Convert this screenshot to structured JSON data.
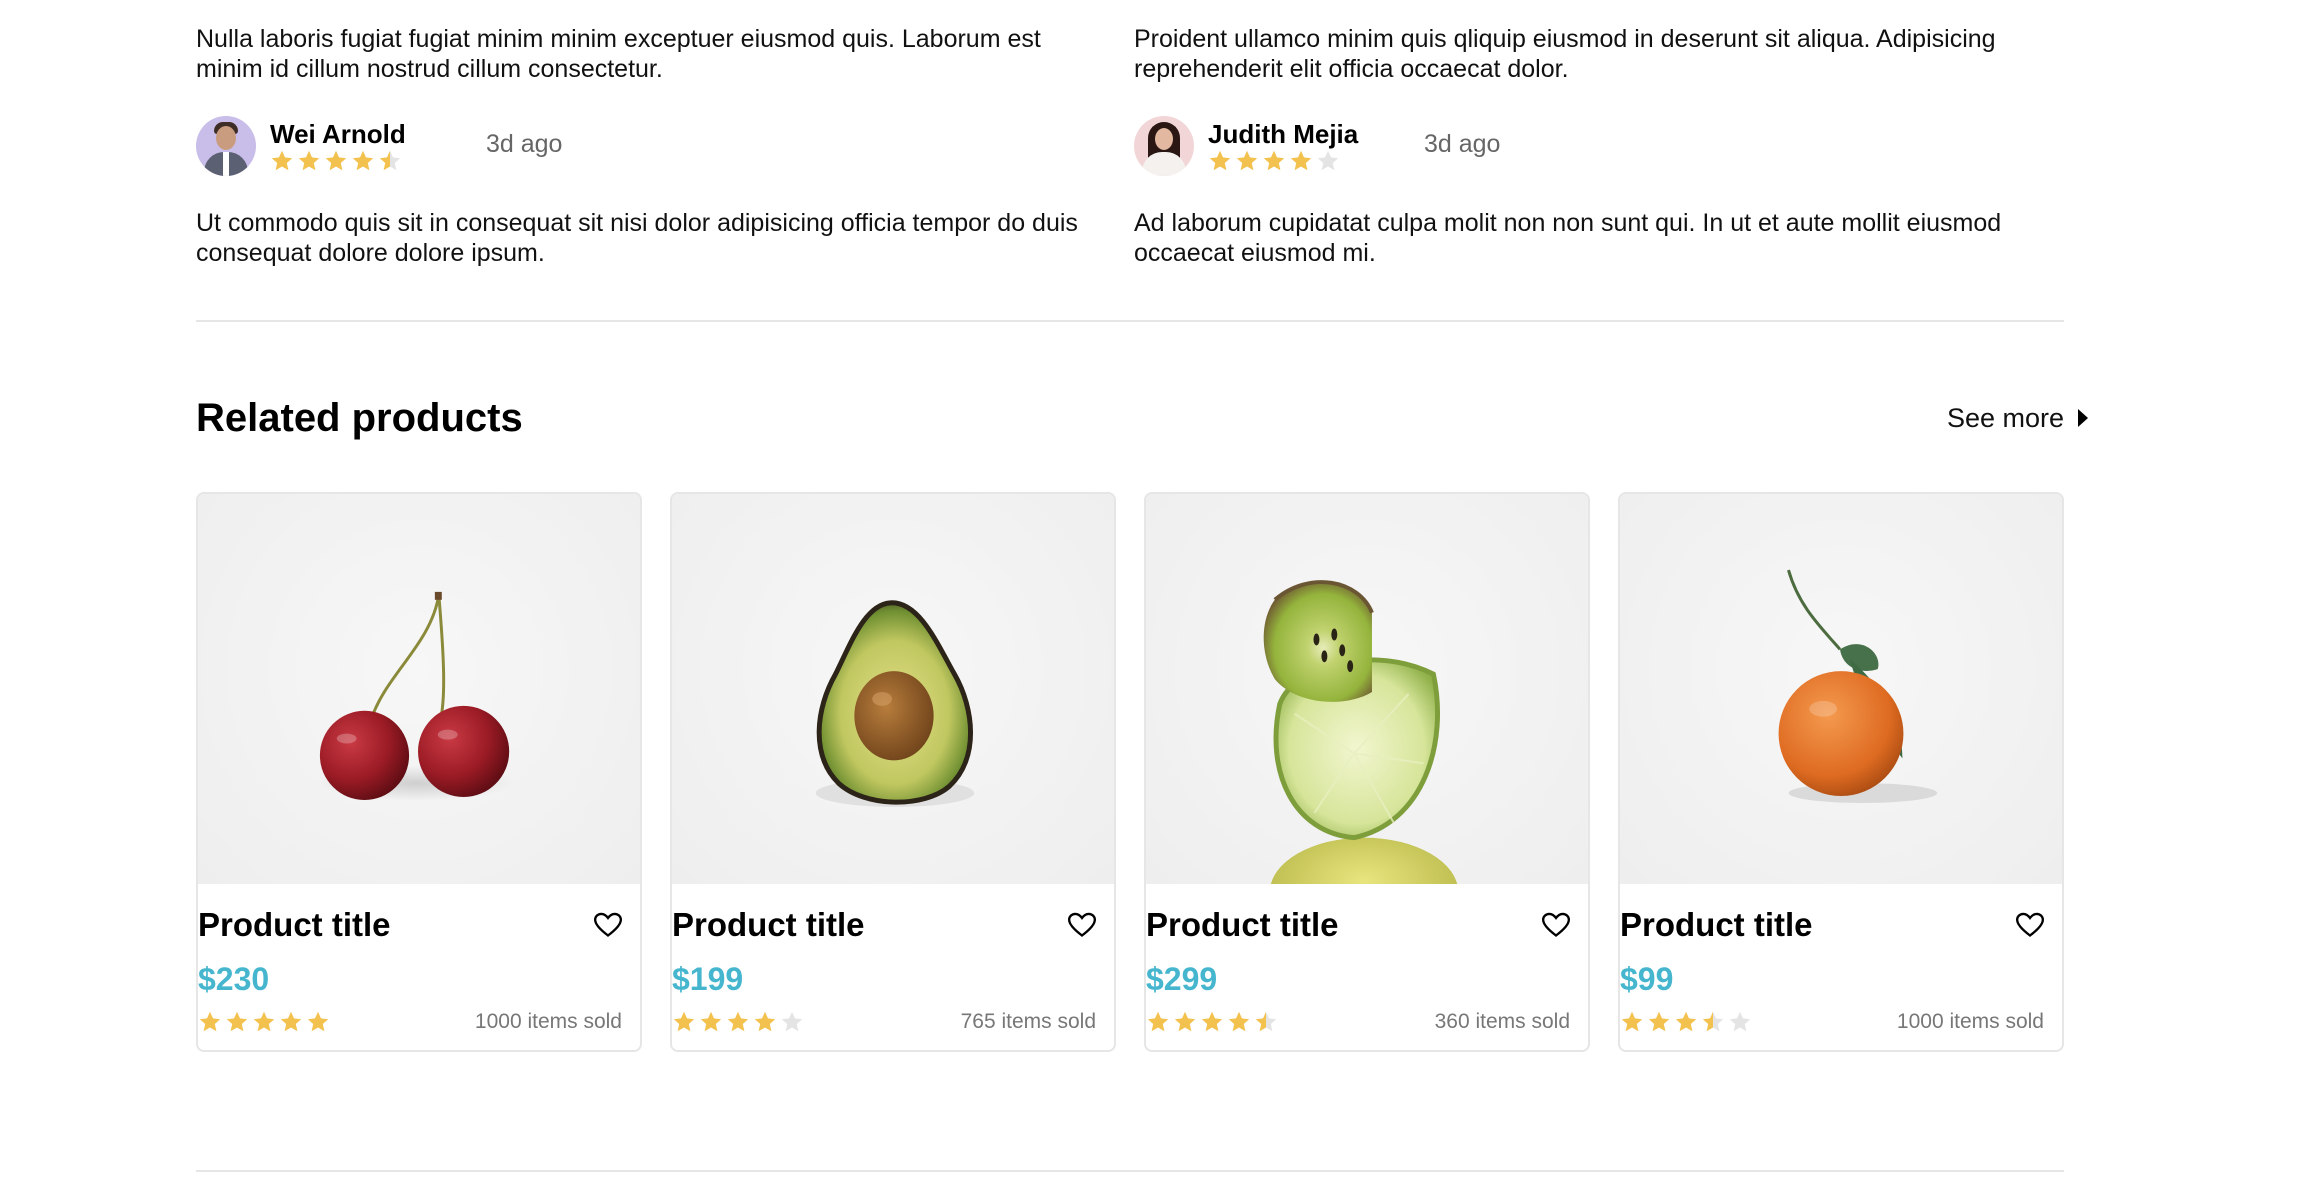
{
  "reviews": [
    {
      "top_text": "Nulla laboris fugiat fugiat minim minim exceptuer eiusmod quis. Laborum est minim id cillum nostrud cillum consectetur.",
      "author": "Wei Arnold",
      "rating": 4.5,
      "time_ago": "3d ago",
      "avatar_icon": "male-avatar",
      "text": "Ut commodo quis sit in consequat sit nisi dolor adipisicing officia tempor do duis consequat dolore dolore ipsum."
    },
    {
      "top_text": "Proident ullamco minim quis qliquip eiusmod in deserunt sit aliqua. Adipisicing reprehenderit elit officia occaecat dolor.",
      "author": "Judith Mejia",
      "rating": 4,
      "time_ago": "3d ago",
      "avatar_icon": "female-avatar",
      "text": "Ad laborum cupidatat culpa molit non non sunt qui. In ut et aute mollit eiusmod occaecat eiusmod mi."
    }
  ],
  "related": {
    "title": "Related products",
    "see_more": "See more"
  },
  "products": [
    {
      "title": "Product title",
      "price": "$230",
      "rating": 5,
      "sold": "1000 items sold",
      "image": "cherries"
    },
    {
      "title": "Product title",
      "price": "$199",
      "rating": 4,
      "sold": "765 items sold",
      "image": "avocado"
    },
    {
      "title": "Product title",
      "price": "$299",
      "rating": 4.5,
      "sold": "360 items sold",
      "image": "kiwi-lime"
    },
    {
      "title": "Product title",
      "price": "$99",
      "rating": 3.5,
      "sold": "1000 items sold",
      "image": "tangerine"
    }
  ],
  "colors": {
    "star_filled": "#f2c14e",
    "star_empty": "#e4e4e4",
    "price": "#46b6cf",
    "divider": "#e6e6e6"
  }
}
